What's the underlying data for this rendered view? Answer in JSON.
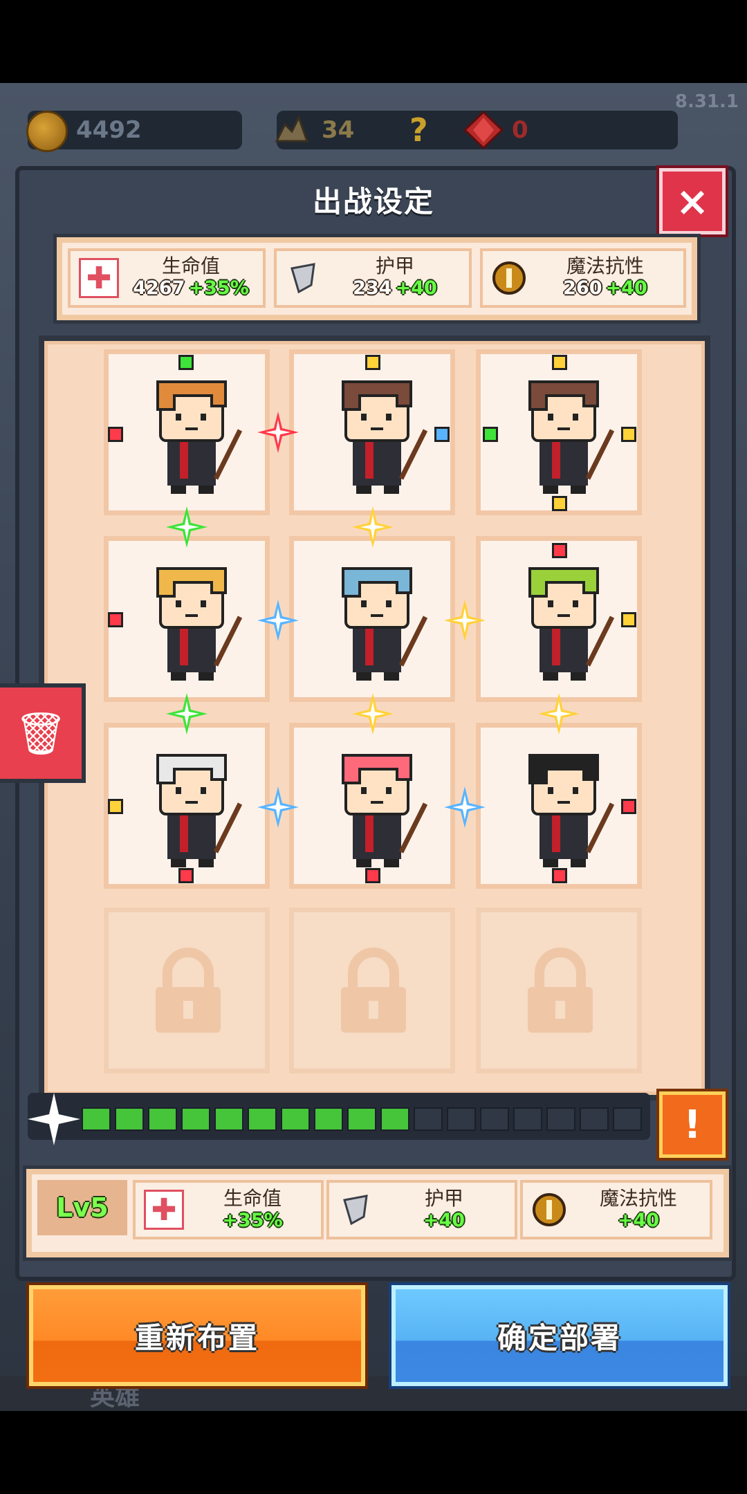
{
  "version": "8.31.1",
  "resources": {
    "gold": "4492",
    "relic": "34",
    "help_icon": "?",
    "gem": "0"
  },
  "dialog": {
    "title": "出战设定",
    "close_icon": "×"
  },
  "team_stats": [
    {
      "name": "生命值",
      "value": "4267",
      "bonus": "+35%",
      "icon": "health-cross-icon"
    },
    {
      "name": "护甲",
      "value": "234",
      "bonus": "+40",
      "icon": "armor-shield-icon"
    },
    {
      "name": "魔法抗性",
      "value": "260",
      "bonus": "+40",
      "icon": "magic-resist-icon"
    }
  ],
  "formation": {
    "rows": 4,
    "cols": 3,
    "slots": [
      {
        "hero": "orange-hair-swordsman",
        "hair": "#e08a3c"
      },
      {
        "hero": "brown-hair-glasses-mage",
        "hair": "#7a4a3a"
      },
      {
        "hero": "ponytail-staff-mage",
        "hair": "#7a4a3a"
      },
      {
        "hero": "blonde-archer",
        "hair": "#f0b84a"
      },
      {
        "hero": "blue-hair-swordsman",
        "hair": "#7ab6d8"
      },
      {
        "hero": "green-hair-druid",
        "hair": "#9ad13a"
      },
      {
        "hero": "white-hair-elder-mage",
        "hair": "#e8e8e8"
      },
      {
        "hero": "pink-hair-shaman",
        "hair": "#ff6a7a"
      },
      {
        "hero": "black-hair-fire-mage",
        "hair": "#222222"
      },
      {
        "hero": "locked"
      },
      {
        "hero": "locked"
      },
      {
        "hero": "locked"
      }
    ]
  },
  "trash_icon": "🗑",
  "progress": {
    "filled": 10,
    "total": 17,
    "alert_icon": "!"
  },
  "level_bonus": {
    "level": "Lv5",
    "stats": [
      {
        "name": "生命值",
        "bonus": "+35%"
      },
      {
        "name": "护甲",
        "bonus": "+40"
      },
      {
        "name": "魔法抗性",
        "bonus": "+40"
      }
    ]
  },
  "buttons": {
    "reset": "重新布置",
    "confirm": "确定部署"
  },
  "bottom_tab_partial": "英雄",
  "colors": {
    "green_link": "#3ee43a",
    "yellow_link": "#ffd23a",
    "blue_link": "#59b4ff",
    "red_link": "#ff3a4a"
  }
}
